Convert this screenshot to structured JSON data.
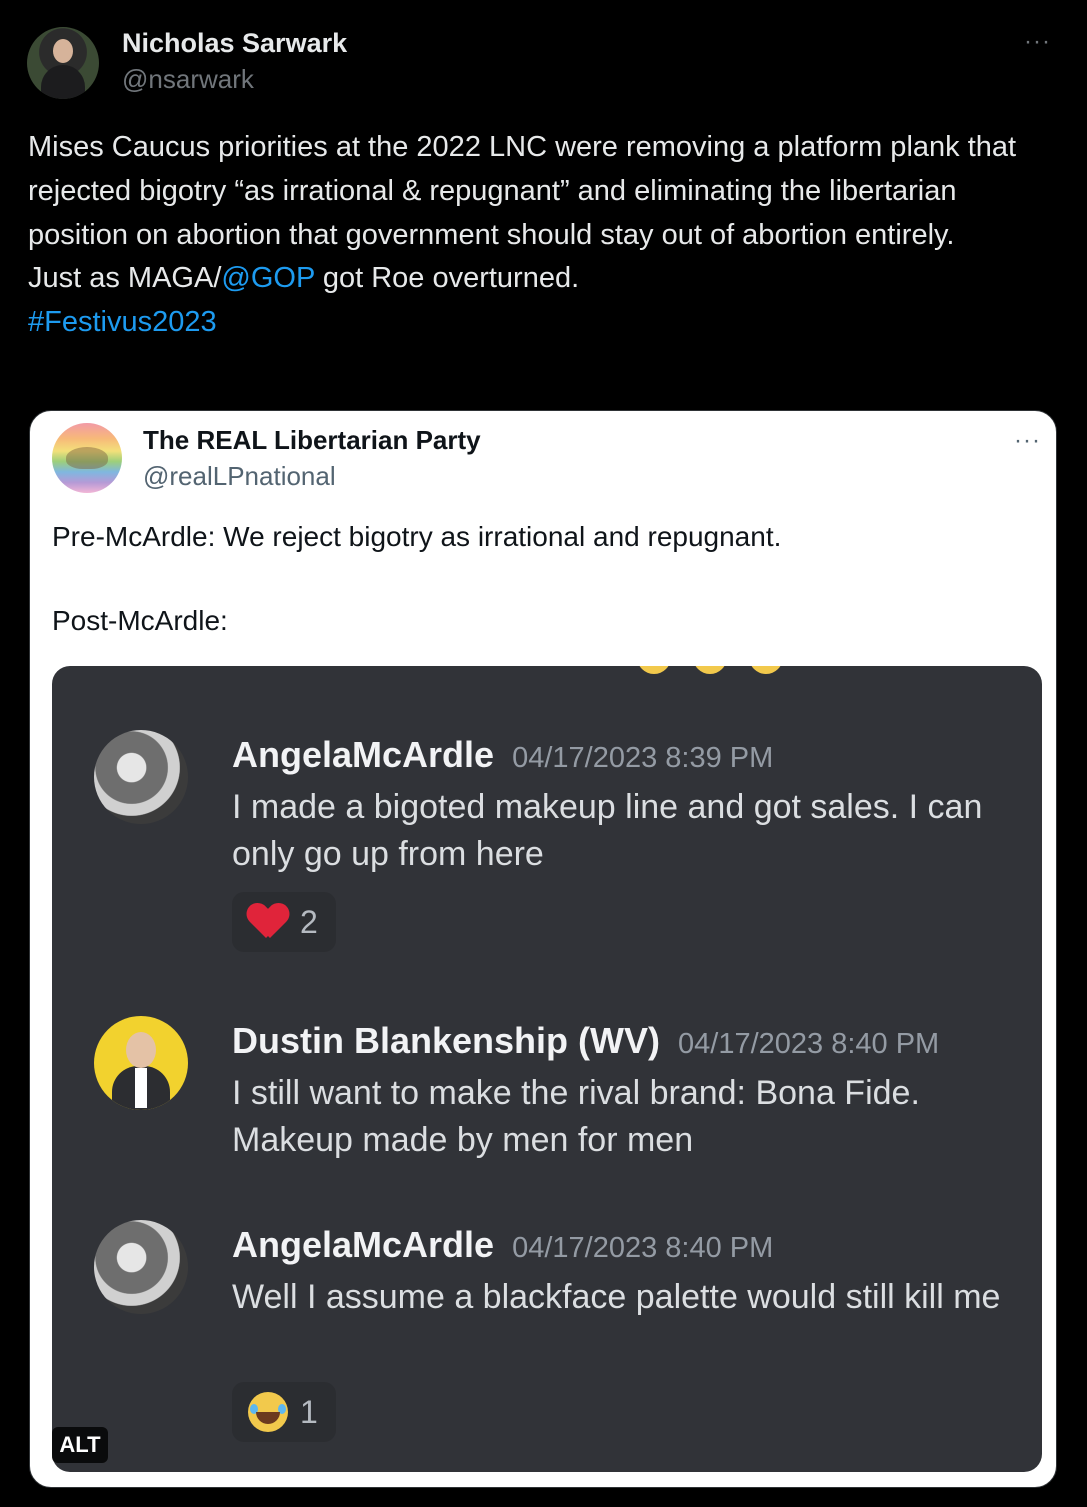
{
  "tweet": {
    "author_name": "Nicholas Sarwark",
    "author_handle": "@nsarwark",
    "more_label": "···",
    "text_parts": {
      "line1": "Mises Caucus priorities at the 2022 LNC were removing a platform plank that rejected bigotry “as irrational & repugnant” and eliminating the libertarian position on abortion that government should stay out of abortion entirely.",
      "line2_prefix": "Just as MAGA/",
      "mention": "@GOP",
      "line2_suffix": " got Roe overturned.",
      "hashtag": "#Festivus2023"
    },
    "link_color": "#1d9bf0"
  },
  "quote": {
    "author_name": "The REAL Libertarian Party",
    "author_handle": "@realLPnational",
    "more_label": "···",
    "text1": "Pre-McArdle: We reject bigotry as irrational and repugnant.",
    "text2": "Post-McArdle:",
    "image": {
      "alt_badge": "ALT",
      "messages": [
        {
          "name": "AngelaMcArdle",
          "time": "04/17/2023 8:39 PM",
          "body": "I made a bigoted makeup line and got sales. I can only go up from here",
          "reaction": {
            "emoji": "heart-icon",
            "count": "2"
          }
        },
        {
          "name": "Dustin Blankenship (WV)",
          "time": "04/17/2023 8:40 PM",
          "body": "I still want to make the rival brand: Bona Fide. Makeup made by men for men"
        },
        {
          "name": "AngelaMcArdle",
          "time": "04/17/2023 8:40 PM",
          "body": "Well I assume a blackface palette would still kill me",
          "reaction": {
            "emoji": "laughing-emoji-icon",
            "count": "1"
          }
        }
      ]
    }
  }
}
